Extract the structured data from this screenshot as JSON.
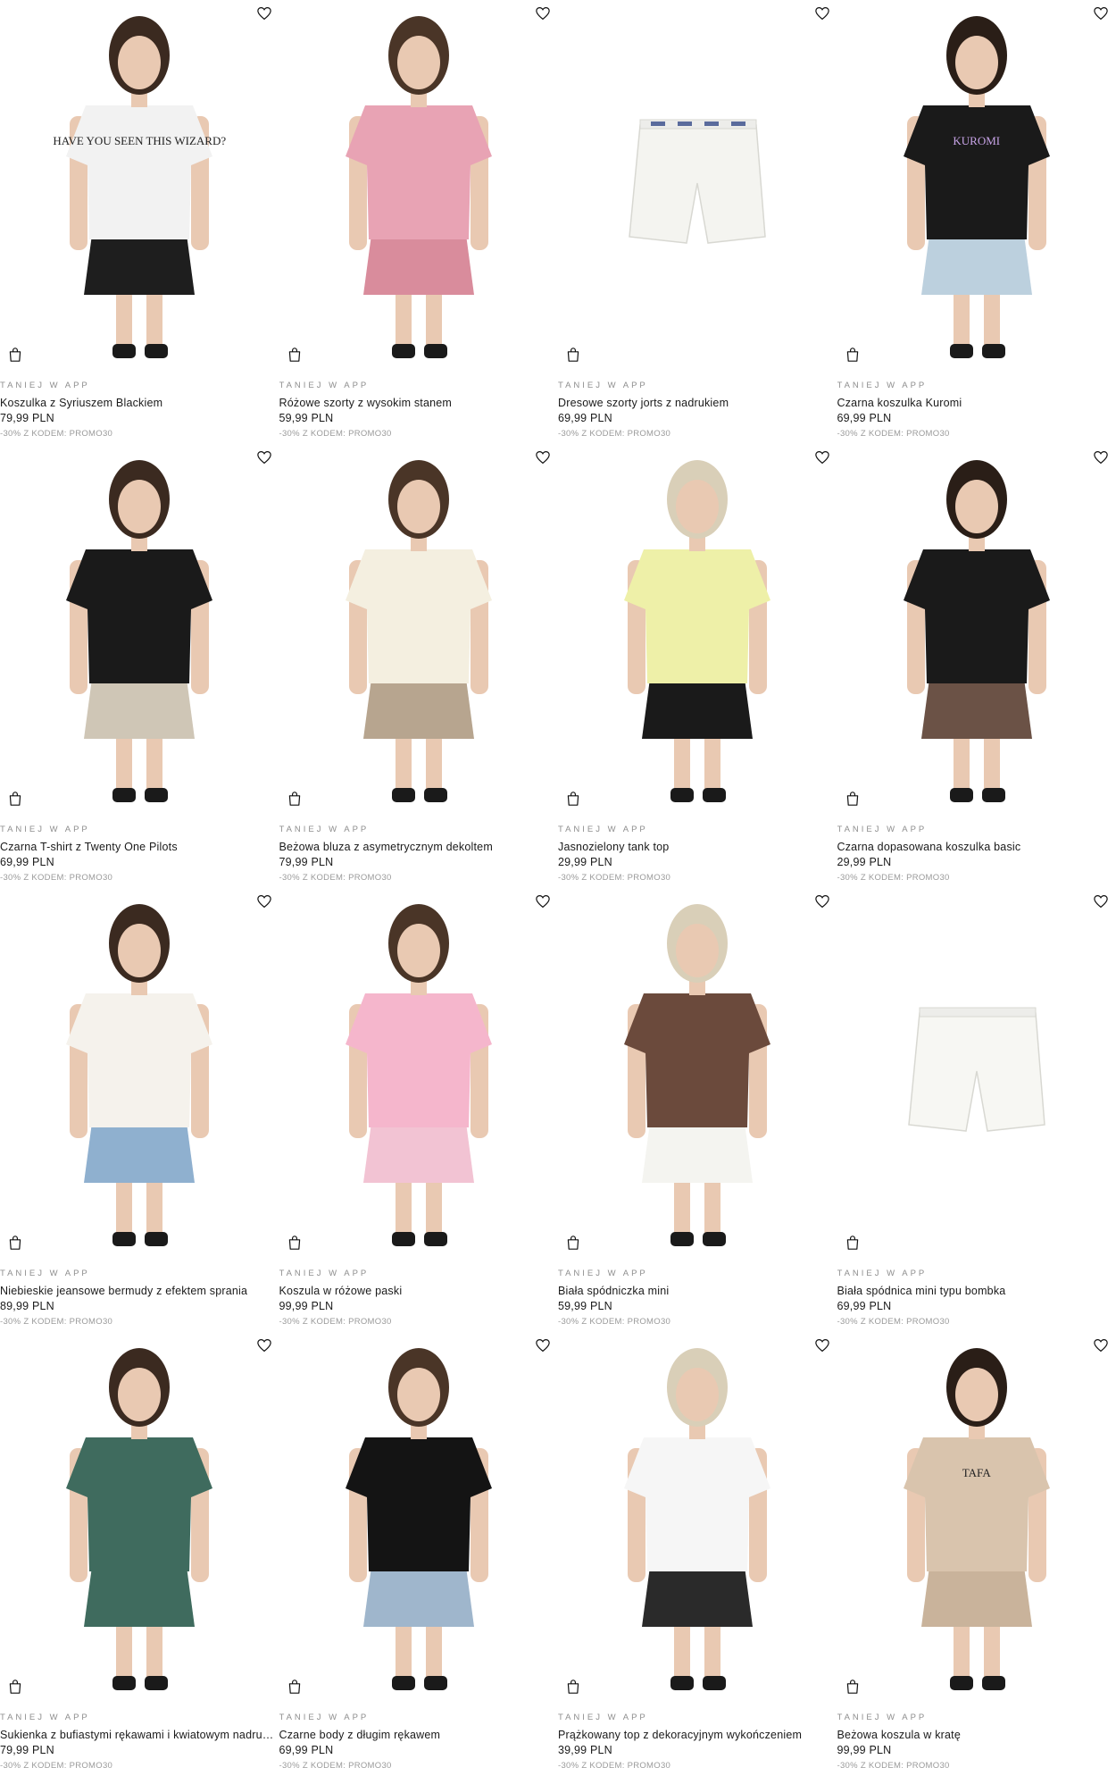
{
  "colors": {
    "accent": "#111111",
    "muted": "#9a9a9a"
  },
  "icons": {
    "wishlist": "heart-icon",
    "cart": "shopping-bag-icon"
  },
  "products": [
    {
      "promo_label": "TANIEJ W APP",
      "name": "Koszulka z Syriuszem Blackiem",
      "price": "79,99 PLN",
      "discount": "-30% Z KODEM: PROMO30",
      "print_text": "HAVE YOU SEEN THIS WIZARD?",
      "top": "#f2f2f2",
      "bottom": "#1e1e1e",
      "bg": "#ffffff"
    },
    {
      "promo_label": "TANIEJ W APP",
      "name": "Różowe szorty z wysokim stanem",
      "price": "59,99 PLN",
      "discount": "-30% Z KODEM: PROMO30",
      "top": "#e8a3b4",
      "bottom": "#d98c9c",
      "bg": "#ffffff"
    },
    {
      "promo_label": "TANIEJ W APP",
      "name": "Dresowe szorty jorts z nadrukiem",
      "price": "69,99 PLN",
      "discount": "-30% Z KODEM: PROMO30",
      "top": "",
      "bottom": "#f4f4f0",
      "bg": "#ffffff"
    },
    {
      "promo_label": "TANIEJ W APP",
      "name": "Czarna koszulka Kuromi",
      "price": "69,99 PLN",
      "discount": "-30% Z KODEM: PROMO30",
      "print_text": "KUROMI",
      "top": "#1a1a1a",
      "bottom": "#bcd0de",
      "bg": "#ffffff"
    },
    {
      "promo_label": "TANIEJ W APP",
      "name": "Czarna T-shirt z Twenty One Pilots",
      "price": "69,99 PLN",
      "discount": "-30% Z KODEM: PROMO30",
      "top": "#1a1a1a",
      "bottom": "#cfc6b6",
      "bg": "#ffffff"
    },
    {
      "promo_label": "TANIEJ W APP",
      "name": "Beżowa bluza z asymetrycznym dekoltem",
      "price": "79,99 PLN",
      "discount": "-30% Z KODEM: PROMO30",
      "top": "#f4efe0",
      "bottom": "#b7a58f",
      "bg": "#ffffff"
    },
    {
      "promo_label": "TANIEJ W APP",
      "name": "Jasnozielony tank top",
      "price": "29,99 PLN",
      "discount": "-30% Z KODEM: PROMO30",
      "top": "#eef0a8",
      "bottom": "#1a1a1a",
      "bg": "#ffffff"
    },
    {
      "promo_label": "TANIEJ W APP",
      "name": "Czarna dopasowana koszulka basic",
      "price": "29,99 PLN",
      "discount": "-30% Z KODEM: PROMO30",
      "top": "#1a1a1a",
      "bottom": "#6b5246",
      "bg": "#ffffff"
    },
    {
      "promo_label": "TANIEJ W APP",
      "name": "Niebieskie jeansowe bermudy z efektem sprania",
      "price": "89,99 PLN",
      "discount": "-30% Z KODEM: PROMO30",
      "top": "#f5f2ec",
      "bottom": "#8fb0cf",
      "bg": "#ffffff"
    },
    {
      "promo_label": "TANIEJ W APP",
      "name": "Koszula w różowe paski",
      "price": "99,99 PLN",
      "discount": "-30% Z KODEM: PROMO30",
      "top": "#f5b6cc",
      "bottom": "#f2c3d3",
      "bg": "#ffffff"
    },
    {
      "promo_label": "TANIEJ W APP",
      "name": "Biała spódniczka mini",
      "price": "59,99 PLN",
      "discount": "-30% Z KODEM: PROMO30",
      "top": "#6b4a3c",
      "bottom": "#f4f4f0",
      "bg": "#ffffff"
    },
    {
      "promo_label": "TANIEJ W APP",
      "name": "Biała spódnica mini typu bombka",
      "price": "69,99 PLN",
      "discount": "-30% Z KODEM: PROMO30",
      "top": "",
      "bottom": "#f7f7f3",
      "bg": "#ffffff"
    },
    {
      "promo_label": "TANIEJ W APP",
      "name": "Sukienka z bufiastymi rękawami i kwiatowym nadrukiem",
      "price": "79,99 PLN",
      "discount": "-30% Z KODEM: PROMO30",
      "top": "#3f6b5e",
      "bottom": "#3f6b5e",
      "bg": "#ffffff"
    },
    {
      "promo_label": "TANIEJ W APP",
      "name": "Czarne body z długim rękawem",
      "price": "69,99 PLN",
      "discount": "-30% Z KODEM: PROMO30",
      "top": "#141414",
      "bottom": "#9fb6cc",
      "bg": "#ffffff"
    },
    {
      "promo_label": "TANIEJ W APP",
      "name": "Prążkowany top z dekoracyjnym wykończeniem",
      "price": "39,99 PLN",
      "discount": "-30% Z KODEM: PROMO30",
      "top": "#f6f6f6",
      "bottom": "#2a2a2a",
      "bg": "#ffffff"
    },
    {
      "promo_label": "TANIEJ W APP",
      "name": "Beżowa koszula w kratę",
      "price": "99,99 PLN",
      "discount": "-30% Z KODEM: PROMO30",
      "print_text": "TAFA",
      "top": "#d9c4ad",
      "bottom": "#c9b39b",
      "bg": "#ffffff"
    }
  ]
}
